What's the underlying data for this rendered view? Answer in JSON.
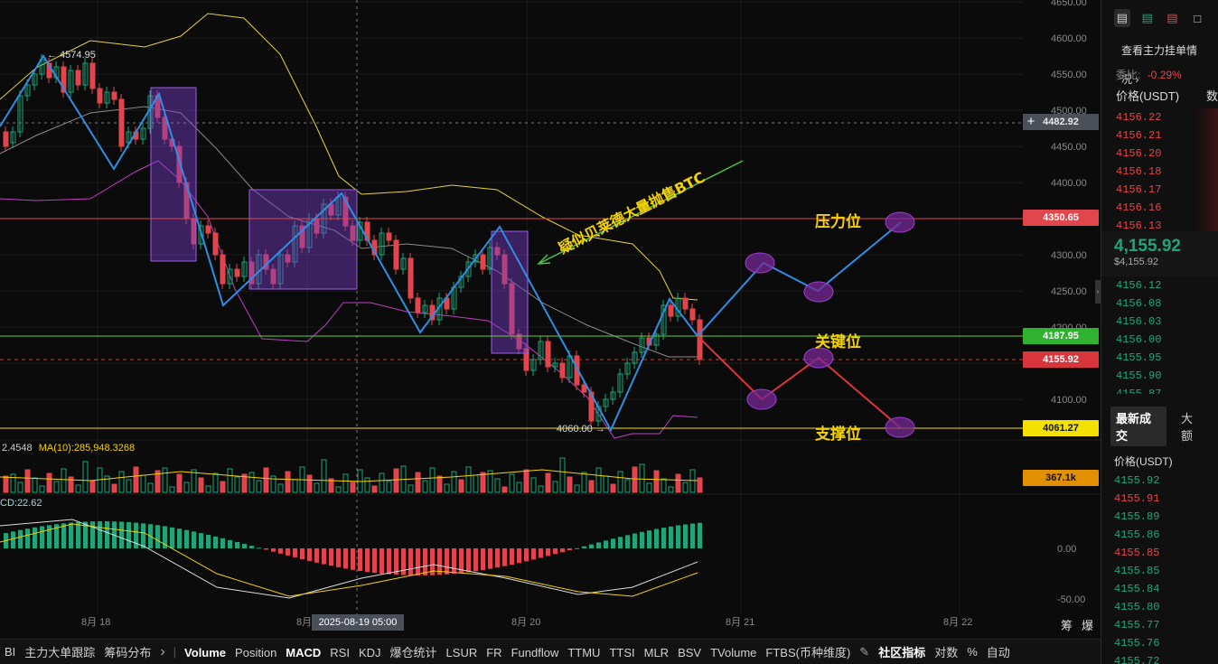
{
  "price_axis": {
    "ticks": [
      "4650.00",
      "4600.00",
      "4550.00",
      "4500.00",
      "4450.00",
      "4400.00",
      "4350.00",
      "4300.00",
      "4250.00",
      "4200.00",
      "4150.00",
      "4100.00"
    ],
    "tags": {
      "crosshair": "4482.92",
      "resistance": "4350.65",
      "key": "4187.95",
      "current": "4155.92",
      "support": "4061.27",
      "volume": "367.1k"
    },
    "macd_ticks": [
      "0.00",
      "-50.00"
    ],
    "colors": {
      "resistance": "#e0464b",
      "key": "#2fb32f",
      "current": "#d7363c",
      "support": "#f5e100",
      "volume": "#e09000",
      "crosshair": "#4a4f58"
    }
  },
  "time_axis": {
    "labels": [
      "8月 18",
      "8月",
      "8月 20",
      "8月 21",
      "8月 22"
    ],
    "crosshair_label": "2025-08-19 05:00",
    "right_buttons": [
      "筹",
      "爆"
    ]
  },
  "chart_labels": {
    "high_label": "← 4574.95",
    "low_label": "4060.00 →",
    "annotation_text": "疑似贝莱德大量抛售BTC",
    "resistance_label": "压力位",
    "key_label": "关键位",
    "support_label": "支撑位",
    "volume_ma_prefix": "2.4548",
    "volume_ma_text": "MA(10):285,948.3268",
    "macd_text": "CD:22.62"
  },
  "bottom_toolbar": {
    "items": [
      "BI",
      "主力大单跟踪",
      "筹码分布"
    ],
    "chevron": "›",
    "indicators": [
      "Volume",
      "Position",
      "MACD",
      "RSI",
      "KDJ",
      "爆仓统计",
      "LSUR",
      "FR",
      "Fundflow",
      "TTMU",
      "TTSI",
      "MLR",
      "BSV",
      "TVolume",
      "FTBS(币种维度)"
    ],
    "active": [
      "Volume",
      "MACD"
    ],
    "community": "社区指标",
    "right_items": [
      "对数",
      "%",
      "自动"
    ]
  },
  "right_panel": {
    "view_main_orders": "查看主力挂单情况",
    "ratio_label": "委比:",
    "ratio_value": "-0.29%",
    "price_header": "价格(USDT)",
    "amount_header": "数",
    "asks": [
      "4156.22",
      "4156.21",
      "4156.20",
      "4156.18",
      "4156.17",
      "4156.16",
      "4156.13"
    ],
    "last_price": "4,155.92",
    "last_price_usd": "$4,155.92",
    "bids": [
      "4156.12",
      "4156.08",
      "4156.03",
      "4156.00",
      "4155.95",
      "4155.90",
      "4155.87"
    ],
    "tabs": [
      "最新成交",
      "大额"
    ],
    "trades_header": "价格(USDT)",
    "trades": [
      {
        "p": "4155.92",
        "side": "buy"
      },
      {
        "p": "4155.91",
        "side": "sell"
      },
      {
        "p": "4155.89",
        "side": "buy"
      },
      {
        "p": "4155.86",
        "side": "buy"
      },
      {
        "p": "4155.85",
        "side": "sell"
      },
      {
        "p": "4155.85",
        "side": "buy"
      },
      {
        "p": "4155.84",
        "side": "buy"
      },
      {
        "p": "4155.80",
        "side": "buy"
      },
      {
        "p": "4155.77",
        "side": "buy"
      },
      {
        "p": "4155.76",
        "side": "buy"
      },
      {
        "p": "4155.72",
        "side": "buy"
      }
    ]
  }
}
